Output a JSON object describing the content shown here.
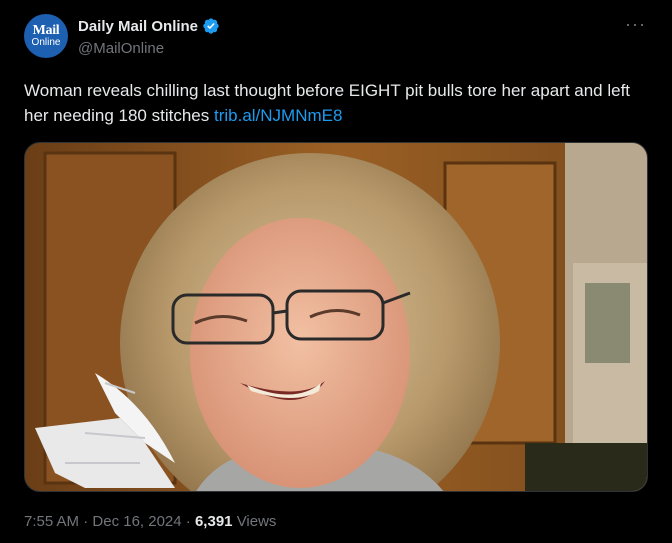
{
  "account": {
    "display_name": "Daily Mail Online",
    "handle": "@MailOnline",
    "avatar_line1": "Mail",
    "avatar_line2": "Online",
    "verified_icon": "verified-badge-icon"
  },
  "menu": {
    "more_label": "···"
  },
  "tweet": {
    "text": "Woman reveals chilling last thought before EIGHT pit bulls tore her apart and left her needing 180 stitches",
    "link": "trib.al/NJMNmE8"
  },
  "meta": {
    "time": "7:55 AM",
    "separator": "·",
    "date": "Dec 16, 2024",
    "views_count": "6,391",
    "views_label": "Views"
  },
  "colors": {
    "background": "#000000",
    "text": "#e7e9ea",
    "secondary": "#71767b",
    "link": "#1d9bf0",
    "avatar": "#1d5fb0"
  }
}
